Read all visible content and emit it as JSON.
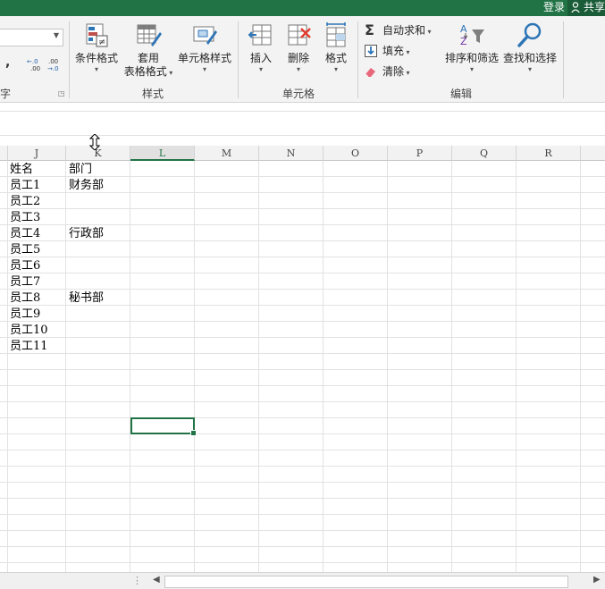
{
  "title_bar": {
    "login": "登录",
    "share": "共享"
  },
  "ribbon": {
    "partial_left_labels": {
      "comma": ",",
      "group_fragment": "字"
    },
    "styles": {
      "conditional_format": "条件格式",
      "table_format_line1": "套用",
      "table_format_line2": "表格格式",
      "cell_styles": "单元格样式",
      "group_label": "样式"
    },
    "cells": {
      "insert": "插入",
      "delete": "删除",
      "format": "格式",
      "group_label": "单元格"
    },
    "editing": {
      "autosum": "自动求和",
      "fill": "填充",
      "clear": "清除",
      "sort_filter": "排序和筛选",
      "find_select": "查找和选择",
      "group_label": "编辑"
    },
    "colors": {
      "accent": "#217346"
    }
  },
  "sheet": {
    "columns": [
      "J",
      "K",
      "L",
      "M",
      "N",
      "O",
      "P",
      "Q",
      "R"
    ],
    "selected_column": "L",
    "rows": [
      {
        "j": "姓名",
        "k": "部门"
      },
      {
        "j": "员工1",
        "k": "财务部"
      },
      {
        "j": "员工2",
        "k": ""
      },
      {
        "j": "员工3",
        "k": ""
      },
      {
        "j": "员工4",
        "k": "行政部"
      },
      {
        "j": "员工5",
        "k": ""
      },
      {
        "j": "员工6",
        "k": ""
      },
      {
        "j": "员工7",
        "k": ""
      },
      {
        "j": "员工8",
        "k": "秘书部"
      },
      {
        "j": "员工9",
        "k": ""
      },
      {
        "j": "员工10",
        "k": ""
      },
      {
        "j": "员工11",
        "k": ""
      }
    ]
  }
}
